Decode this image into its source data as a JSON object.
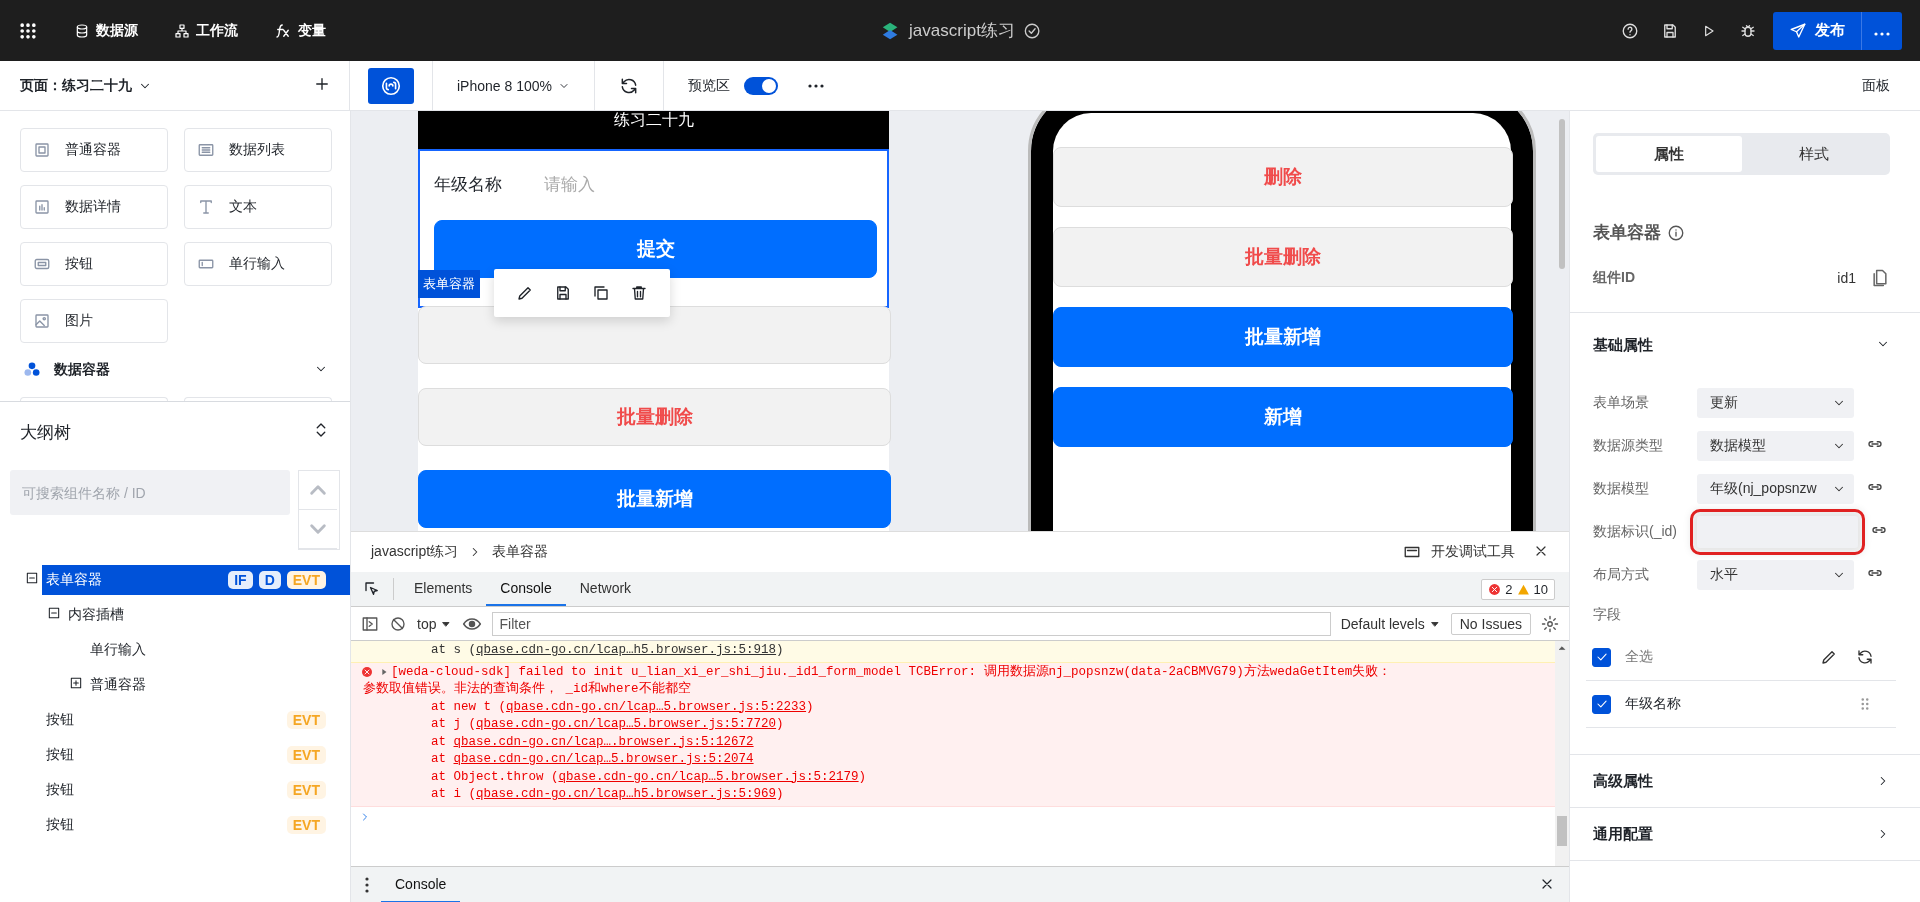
{
  "top_bar": {
    "nav": [
      {
        "label": "数据源",
        "kind": "database"
      },
      {
        "label": "工作流",
        "kind": "flow"
      },
      {
        "label": "变量",
        "kind": "function"
      }
    ],
    "title": "javascript练习",
    "publish": "发布"
  },
  "page_bar": {
    "page_label": "页面：练习二十九",
    "device": "iPhone 8 100%",
    "preview_label": "预览区",
    "preview_on": true,
    "panel": "面板"
  },
  "components": [
    {
      "label": "普通容器",
      "kind": "container"
    },
    {
      "label": "数据列表",
      "kind": "list"
    },
    {
      "label": "数据详情",
      "kind": "detail"
    },
    {
      "label": "文本",
      "kind": "text"
    },
    {
      "label": "按钮",
      "kind": "button"
    },
    {
      "label": "单行输入",
      "kind": "input"
    },
    {
      "label": "图片",
      "kind": "image"
    }
  ],
  "component_group": {
    "title": "数据容器"
  },
  "outline": {
    "title": "大纲树",
    "search_placeholder": "可搜索组件名称 / ID",
    "tree": [
      {
        "label": "表单容器",
        "selected": true,
        "expanded": true,
        "tags": [
          {
            "label": "IF",
            "kind": "condition"
          },
          {
            "label": "D",
            "kind": "data"
          },
          {
            "label": "EVT",
            "kind": "event"
          }
        ],
        "children": [
          {
            "label": "内容插槽",
            "selected": false,
            "expanded": true,
            "children": [
              {
                "label": "单行输入",
                "selected": false
              },
              {
                "label": "普通容器",
                "selected": false,
                "expanded": false
              }
            ]
          }
        ]
      },
      {
        "label": "按钮",
        "selected": false,
        "tags": [
          {
            "label": "EVT",
            "kind": "event"
          }
        ]
      },
      {
        "label": "按钮",
        "selected": false,
        "tags": [
          {
            "label": "EVT",
            "kind": "event"
          }
        ]
      },
      {
        "label": "按钮",
        "selected": false,
        "tags": [
          {
            "label": "EVT",
            "kind": "event"
          }
        ]
      },
      {
        "label": "按钮",
        "selected": false,
        "tags": [
          {
            "label": "EVT",
            "kind": "event"
          }
        ]
      }
    ]
  },
  "canvas_left": {
    "header": "练习二十九",
    "field_label": "年级名称",
    "placeholder": "请输入",
    "submit": "提交",
    "selection_tag": "表单容器",
    "buttons": [
      {
        "kind": "secondary"
      },
      {
        "label": "批量删除",
        "kind": "secondary"
      },
      {
        "label": "批量新增",
        "kind": "primary"
      }
    ]
  },
  "canvas_right": {
    "buttons": [
      {
        "label": "删除",
        "kind": "secondary"
      },
      {
        "label": "批量删除",
        "kind": "secondary"
      },
      {
        "label": "批量新增",
        "kind": "primary"
      },
      {
        "label": "新增",
        "kind": "primary"
      }
    ]
  },
  "devtools": {
    "breadcrumb": [
      "javascript练习",
      "表单容器"
    ],
    "title": "开发调试工具",
    "tabs": [
      {
        "label": "Elements",
        "selected": false
      },
      {
        "label": "Console",
        "selected": true
      },
      {
        "label": "Network",
        "selected": false
      }
    ],
    "errors": "2",
    "warnings": "10",
    "context": "top",
    "filter_placeholder": "Filter",
    "levels": "Default levels",
    "issues": "No Issues",
    "log": [
      {
        "kind": "warning",
        "stack": [
          {
            "text": "at s (",
            "link": "qbase.cdn-go.cn/lcap…h5.browser.js:5:918",
            "end": ")"
          }
        ]
      },
      {
        "kind": "error",
        "message": [
          "[weda-cloud-sdk] failed to init u_lian_xi_er_shi_jiu._id1_form_model TCBError: 调用数据源nj_popsnzw(data-2aCBMVG79)方法wedaGetItem失败：",
          "参数取值错误。非法的查询条件， _id和where不能都空"
        ],
        "stack": [
          {
            "text": "at new t (",
            "link": "qbase.cdn-go.cn/lcap…5.browser.js:5:2233",
            "end": ")"
          },
          {
            "text": "at j (",
            "link": "qbase.cdn-go.cn/lcap…5.browser.js:5:7720",
            "end": ")"
          },
          {
            "text": "at ",
            "link": "qbase.cdn-go.cn/lcap….browser.js:5:12672"
          },
          {
            "text": "at ",
            "link": "qbase.cdn-go.cn/lcap…5.browser.js:5:2074"
          },
          {
            "text": "at Object.throw (",
            "link": "qbase.cdn-go.cn/lcap…5.browser.js:5:2179",
            "end": ")"
          },
          {
            "text": "at i (",
            "link": "qbase.cdn-go.cn/lcap…h5.browser.js:5:969",
            "end": ")"
          }
        ]
      }
    ],
    "drawer_tab": "Console"
  },
  "properties": {
    "tabs": [
      {
        "label": "属性",
        "selected": true
      },
      {
        "label": "样式",
        "selected": false
      }
    ],
    "heading": "表单容器",
    "id_label": "组件ID",
    "id_value": "id1",
    "section": {
      "title": "基础属性",
      "expanded": true
    },
    "rows": [
      {
        "label": "表单场景",
        "value": "更新",
        "kind": "select",
        "bindable": false
      },
      {
        "label": "数据源类型",
        "value": "数据模型",
        "kind": "select",
        "bindable": true
      },
      {
        "label": "数据模型",
        "value": "年级(nj_popsnzw",
        "kind": "select",
        "bindable": true
      },
      {
        "label": "数据标识(_id)",
        "kind": "input",
        "bindable": true,
        "annotated": true
      },
      {
        "label": "布局方式",
        "value": "水平",
        "kind": "select",
        "bindable": true
      }
    ],
    "fields_label": "字段",
    "select_all": {
      "label": "全选",
      "checked": true
    },
    "fields": [
      {
        "label": "年级名称",
        "checked": true
      }
    ],
    "more_sections": [
      {
        "title": "高级属性"
      },
      {
        "title": "通用配置"
      }
    ]
  }
}
